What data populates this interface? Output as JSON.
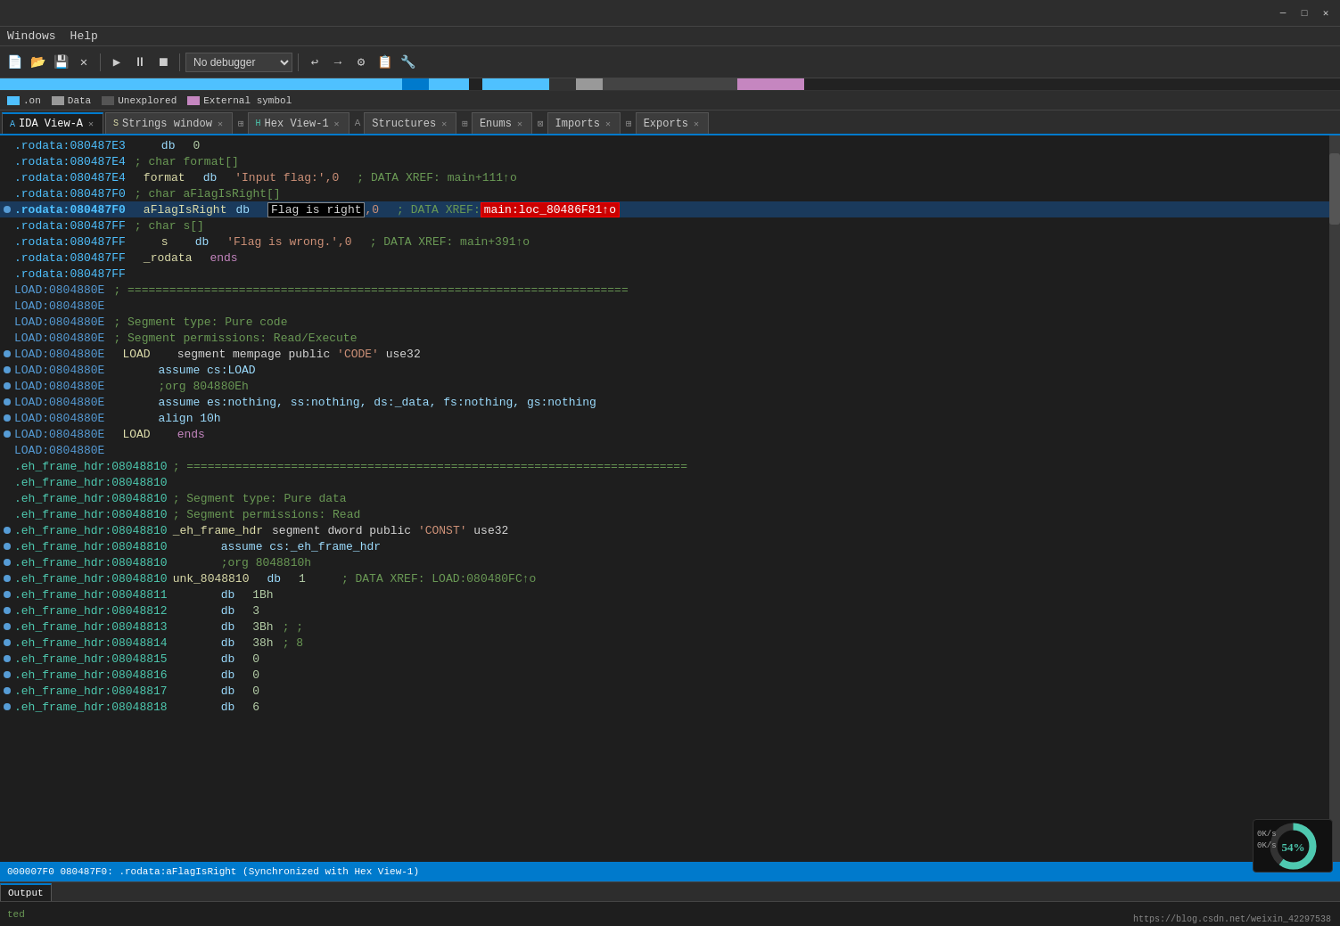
{
  "titlebar": {
    "minimize": "─",
    "maximize": "□",
    "close": "✕"
  },
  "menubar": {
    "items": [
      "Windows",
      "Help"
    ]
  },
  "toolbar": {
    "debugger_label": "No debugger"
  },
  "legend": {
    "items": [
      {
        "label": ".on",
        "color": "#4fc1ff"
      },
      {
        "label": "Data",
        "color": "#999"
      },
      {
        "label": "Unexplored",
        "color": "#444"
      },
      {
        "label": "External symbol",
        "color": "#c586c0"
      }
    ]
  },
  "tabs": [
    {
      "id": "ida-view",
      "label": "IDA View-A",
      "active": true,
      "icon": "A"
    },
    {
      "id": "strings",
      "label": "Strings window",
      "active": false,
      "icon": "S"
    },
    {
      "id": "hex-view",
      "label": "Hex View-1",
      "active": false,
      "icon": "H"
    },
    {
      "id": "structures",
      "label": "Structures",
      "active": false,
      "icon": "S"
    },
    {
      "id": "enums",
      "label": "Enums",
      "active": false,
      "icon": "E"
    },
    {
      "id": "imports",
      "label": "Imports",
      "active": false,
      "icon": "I"
    },
    {
      "id": "exports",
      "label": "Exports",
      "active": false,
      "icon": "X"
    }
  ],
  "code_lines": [
    {
      "bullet": false,
      "addr": ".rodata:080487E3",
      "col2": "",
      "col3": "db",
      "col4": "0",
      "col5": ""
    },
    {
      "bullet": false,
      "addr": ".rodata:080487E4 ; char format[]",
      "col2": "",
      "col3": "",
      "col4": "",
      "col5": ""
    },
    {
      "bullet": false,
      "addr": ".rodata:080487E4",
      "col2": "format",
      "col3": "db",
      "col4": "'Input flag:',0",
      "col5": "; DATA XREF: main+111↑o"
    },
    {
      "bullet": false,
      "addr": ".rodata:080487F0 ; char aFlagIsRight[]",
      "col2": "",
      "col3": "",
      "col4": "",
      "col5": ""
    },
    {
      "bullet": true,
      "addr": ".rodata:080487F0",
      "col2": "aFlagIsRight",
      "col3": "db",
      "col4": "FLAG_IS_RIGHT_BOX",
      "col5": "; DATA XREF: MAIN_LOC_BOX"
    },
    {
      "bullet": false,
      "addr": ".rodata:080487FF ; char s[]",
      "col2": "",
      "col3": "",
      "col4": "",
      "col5": ""
    },
    {
      "bullet": false,
      "addr": ".rodata:080487FF",
      "col2": "s",
      "col3": "db",
      "col4": "'Flag is wrong.',0",
      "col5": "; DATA XREF: main+391↑o"
    },
    {
      "bullet": false,
      "addr": ".rodata:080487FF",
      "col2": "_rodata",
      "col3": "ends",
      "col4": "",
      "col5": ""
    },
    {
      "bullet": false,
      "addr": ".rodata:080487FF",
      "col2": "",
      "col3": "",
      "col4": "",
      "col5": ""
    },
    {
      "bullet": false,
      "addr": "LOAD:0804880E ;",
      "col2": "========================================================================",
      "col3": "",
      "col4": "",
      "col5": ""
    },
    {
      "bullet": false,
      "addr": "LOAD:0804880E",
      "col2": "",
      "col3": "",
      "col4": "",
      "col5": ""
    },
    {
      "bullet": false,
      "addr": "LOAD:0804880E ;",
      "col2": "Segment type: Pure code",
      "col3": "",
      "col4": "",
      "col5": ""
    },
    {
      "bullet": false,
      "addr": "LOAD:0804880E ;",
      "col2": "Segment permissions: Read/Execute",
      "col3": "",
      "col4": "",
      "col5": ""
    },
    {
      "bullet": true,
      "addr": "LOAD:0804880E",
      "col2": "LOAD",
      "col3": "segment mempage public 'CODE' use32",
      "col4": "",
      "col5": ""
    },
    {
      "bullet": true,
      "addr": "LOAD:0804880E",
      "col2": "",
      "col3": "assume cs:LOAD",
      "col4": "",
      "col5": ""
    },
    {
      "bullet": true,
      "addr": "LOAD:0804880E",
      "col2": "",
      "col3": ";org 804880Eh",
      "col4": "",
      "col5": ""
    },
    {
      "bullet": true,
      "addr": "LOAD:0804880E",
      "col2": "",
      "col3": "assume es:nothing, ss:nothing, ds:_data, fs:nothing, gs:nothing",
      "col4": "",
      "col5": ""
    },
    {
      "bullet": true,
      "addr": "LOAD:0804880E",
      "col2": "",
      "col3": "align 10h",
      "col4": "",
      "col5": ""
    },
    {
      "bullet": true,
      "addr": "LOAD:0804880E",
      "col2": "LOAD",
      "col3": "ends",
      "col4": "",
      "col5": ""
    },
    {
      "bullet": false,
      "addr": "LOAD:0804880E",
      "col2": "",
      "col3": "",
      "col4": "",
      "col5": ""
    },
    {
      "bullet": false,
      "addr": ".eh_frame_hdr:08048810 ;",
      "col2": "========================================================================",
      "col3": "",
      "col4": "",
      "col5": ""
    },
    {
      "bullet": false,
      "addr": ".eh_frame_hdr:08048810",
      "col2": "",
      "col3": "",
      "col4": "",
      "col5": ""
    },
    {
      "bullet": false,
      "addr": ".eh_frame_hdr:08048810 ;",
      "col2": "Segment type: Pure data",
      "col3": "",
      "col4": "",
      "col5": ""
    },
    {
      "bullet": false,
      "addr": ".eh_frame_hdr:08048810 ;",
      "col2": "Segment permissions: Read",
      "col3": "",
      "col4": "",
      "col5": ""
    },
    {
      "bullet": true,
      "addr": ".eh_frame_hdr:08048810",
      "col2": "_eh_frame_hdr",
      "col3": "segment dword public 'CONST' use32",
      "col4": "",
      "col5": ""
    },
    {
      "bullet": true,
      "addr": ".eh_frame_hdr:08048810",
      "col2": "",
      "col3": "assume cs:_eh_frame_hdr",
      "col4": "",
      "col5": ""
    },
    {
      "bullet": true,
      "addr": ".eh_frame_hdr:08048810",
      "col2": "",
      "col3": ";org 8048810h",
      "col4": "",
      "col5": ""
    },
    {
      "bullet": true,
      "addr": ".eh_frame_hdr:08048810",
      "col2": "unk_8048810",
      "col3": "db",
      "col4": "1",
      "col5": "; DATA XREF: LOAD:080480FC↑o"
    },
    {
      "bullet": true,
      "addr": ".eh_frame_hdr:08048811",
      "col2": "",
      "col3": "db",
      "col4": "1Bh",
      "col5": ""
    },
    {
      "bullet": true,
      "addr": ".eh_frame_hdr:08048812",
      "col2": "",
      "col3": "db",
      "col4": "3",
      "col5": ""
    },
    {
      "bullet": true,
      "addr": ".eh_frame_hdr:08048813",
      "col2": "",
      "col3": "db",
      "col4": "3Bh ; ;",
      "col5": ""
    },
    {
      "bullet": true,
      "addr": ".eh_frame_hdr:08048814",
      "col2": "",
      "col3": "db",
      "col4": "38h ; 8",
      "col5": ""
    },
    {
      "bullet": true,
      "addr": ".eh_frame_hdr:08048815",
      "col2": "",
      "col3": "db",
      "col4": "0",
      "col5": ""
    },
    {
      "bullet": true,
      "addr": ".eh_frame_hdr:08048816",
      "col2": "",
      "col3": "db",
      "col4": "0",
      "col5": ""
    },
    {
      "bullet": true,
      "addr": ".eh_frame_hdr:08048817",
      "col2": "",
      "col3": "db",
      "col4": "0",
      "col5": ""
    },
    {
      "bullet": true,
      "addr": ".eh_frame_hdr:08048818",
      "col2": "",
      "col3": "db",
      "col4": "6",
      "col5": ""
    }
  ],
  "status_bar": {
    "text": "000007F0 080487F0: .rodata:aFlagIsRight (Synchronized with Hex View-1)"
  },
  "bottom": {
    "status": "ted",
    "url": "https://blog.csdn.net/weixin_42297538"
  },
  "network": {
    "up": "0K/s",
    "down": "0K/s",
    "percent": "54"
  },
  "flag_is_right": "Flag is right",
  "main_loc": "main:loc_80486F81↑o"
}
